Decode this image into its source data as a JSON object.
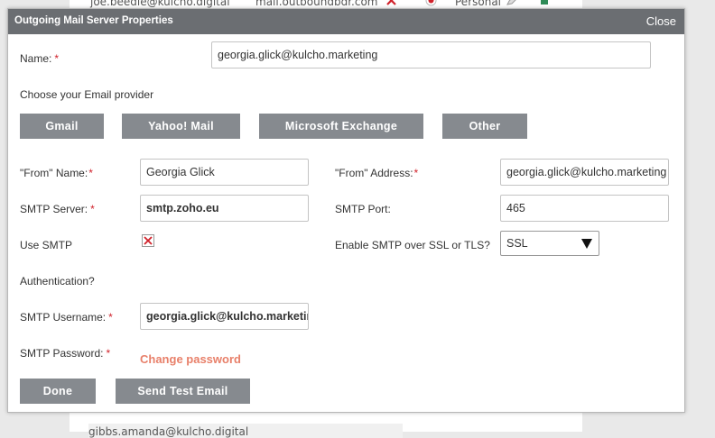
{
  "background": {
    "row_top": {
      "email": "joe.beedle@kulcho.digital",
      "server": "mail.outboundbdr.com",
      "type": "Personal"
    },
    "row_bottom": {
      "text": "gibbs.amanda@kulcho.digital"
    }
  },
  "dialog": {
    "title": "Outgoing Mail Server Properties",
    "close_label": "Close",
    "name_label": "Name:",
    "name_value": "georgia.glick@kulcho.marketing",
    "provider_heading": "Choose your Email provider",
    "providers": [
      "Gmail",
      "Yahoo! Mail",
      "Microsoft Exchange",
      "Other"
    ],
    "from_name_label": "\"From\" Name:",
    "from_name_value": "Georgia Glick",
    "from_address_label": "\"From\" Address:",
    "from_address_value": "georgia.glick@kulcho.marketing",
    "smtp_server_label": "SMTP Server:",
    "smtp_server_value": "smtp.zoho.eu",
    "smtp_port_label": "SMTP Port:",
    "smtp_port_value": "465",
    "use_smtp_label": "Use SMTP",
    "authentication_label": "Authentication?",
    "use_smtp_checked": true,
    "ssl_label": "Enable SMTP over SSL or TLS?",
    "ssl_value": "SSL",
    "smtp_username_label": "SMTP Username:",
    "smtp_username_value": "georgia.glick@kulcho.marketing",
    "smtp_password_label": "SMTP Password:",
    "change_password_label": "Change password",
    "done_label": "Done",
    "send_test_label": "Send Test Email",
    "required_mark": "*"
  },
  "colors": {
    "titlebar": "#6b6e72",
    "button": "#868a8f",
    "required": "#d0212a",
    "link": "#e8806a",
    "checkbox_x": "#d0212a"
  }
}
